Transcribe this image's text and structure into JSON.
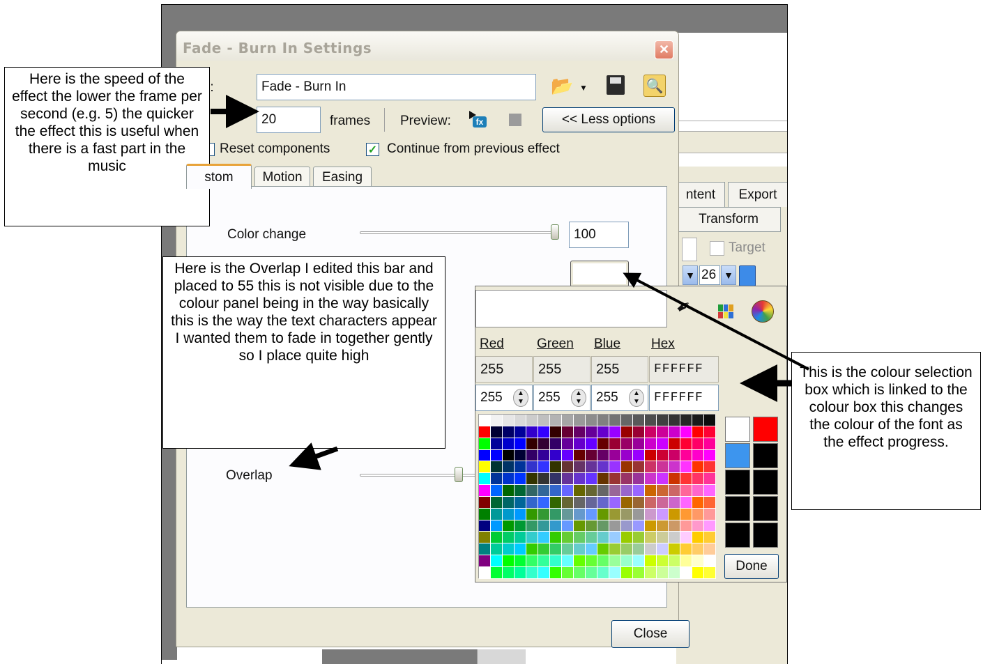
{
  "dialog": {
    "title": "Fade - Burn In Settings",
    "name_label": "me:",
    "name_value": "Fade - Burn In",
    "duration_value": "20",
    "frames_label": "frames",
    "preview_label": "Preview:",
    "less_options_label": "<< Less options",
    "reset_label": "Reset components",
    "continue_label": "Continue from previous effect",
    "continue_checked": true,
    "tabs": [
      "stom",
      "Motion",
      "Easing"
    ],
    "color_change_label": "Color change",
    "color_change_value": "100",
    "overlap_label": "Overlap",
    "close_label": "Close"
  },
  "background_app": {
    "tabs": [
      "ntent",
      "Export"
    ],
    "transform_tab": "Transform",
    "target_label": "Target",
    "size_value": "26"
  },
  "color_picker": {
    "headers": [
      "Red",
      "Green",
      "Blue",
      "Hex"
    ],
    "current": {
      "red": "255",
      "green": "255",
      "blue": "255",
      "hex": "FFFFFF"
    },
    "edit": {
      "red": "255",
      "green": "255",
      "blue": "255",
      "hex": "FFFFFF"
    },
    "done_label": "Done",
    "swatches": [
      "#ffffff",
      "#ff0000",
      "#3d95ee",
      "#000000",
      "#000000",
      "#000000",
      "#000000",
      "#000000",
      "#000000",
      "#000000"
    ]
  },
  "annotations": {
    "speed": "Here is the speed of the effect the lower the frame per second (e.g. 5) the quicker the effect this is useful when there is a fast part in the music",
    "overlap": "Here is the Overlap I edited this bar and placed to 55 this is not visible due to the colour panel being in the way basically this is the way the text characters appear I wanted them to fade in together gently so I place quite high",
    "colour_box": "This is the colour selection box which is linked to the colour box this changes the colour of the font as the effect progress."
  },
  "colors": {
    "accent": "#316ac5",
    "dialog_bg": "#ece9d8",
    "check_green": "#21a121"
  }
}
